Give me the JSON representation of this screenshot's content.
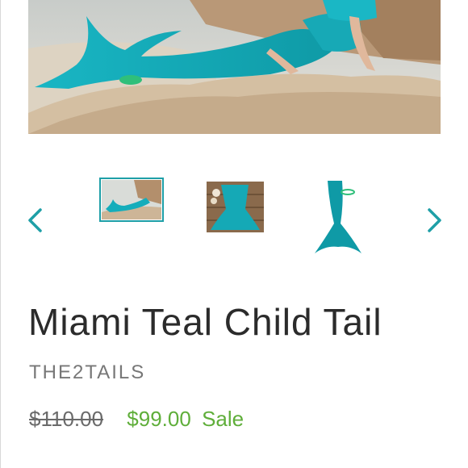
{
  "hero": {
    "icon": "mermaid-photo"
  },
  "carousel": {
    "prev_icon": "chevron-left-icon",
    "next_icon": "chevron-right-icon",
    "accent": "#1e9fa7",
    "thumbnails": [
      {
        "icon": "mermaid-on-rocks-photo",
        "active": true
      },
      {
        "icon": "tail-on-wood-photo",
        "active": false
      },
      {
        "icon": "tail-fin-photo",
        "active": false
      }
    ]
  },
  "product": {
    "title": "Miami Teal Child Tail",
    "vendor": "THE2TAILS",
    "compare_price": "$110.00",
    "sale_price": "$99.00",
    "sale_label": "Sale"
  },
  "colors": {
    "title": "#2b2b2b",
    "vendor": "#777777",
    "sale": "#5fae3a",
    "compare": "#6a6a6a"
  }
}
